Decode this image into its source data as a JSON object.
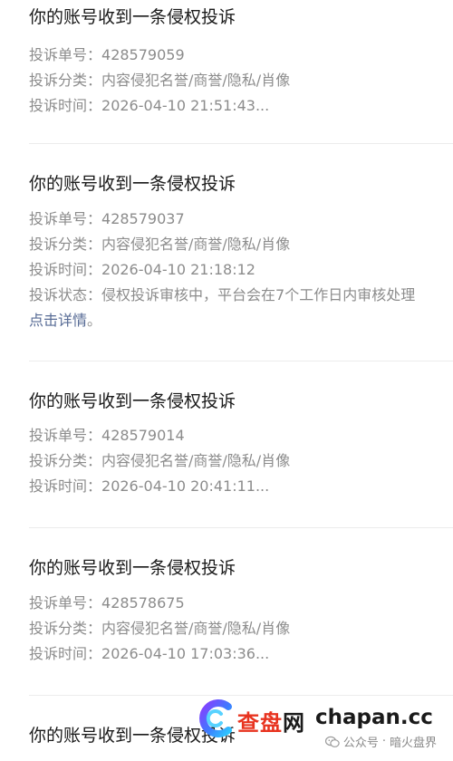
{
  "complaints": [
    {
      "title": "你的账号收到一条侵权投诉",
      "number_label": "投诉单号：",
      "number": "428579059",
      "category_label": "投诉分类：",
      "category": "内容侵犯名誉/商誉/隐私/肖像",
      "time_label": "投诉时间：",
      "time": "2026-04-10 21:51:43..."
    },
    {
      "title": "你的账号收到一条侵权投诉",
      "number_label": "投诉单号：",
      "number": "428579037",
      "category_label": "投诉分类：",
      "category": "内容侵犯名誉/商誉/隐私/肖像",
      "time_label": "投诉时间：",
      "time": "2026-04-10 21:18:12",
      "status_label": "投诉状态：",
      "status": "侵权投诉审核中，平台会在7个工作日内审核处理",
      "detail_link": "点击详情",
      "detail_suffix": "。"
    },
    {
      "title": "你的账号收到一条侵权投诉",
      "number_label": "投诉单号：",
      "number": "428579014",
      "category_label": "投诉分类：",
      "category": "内容侵犯名誉/商誉/隐私/肖像",
      "time_label": "投诉时间：",
      "time": "2026-04-10 20:41:11..."
    },
    {
      "title": "你的账号收到一条侵权投诉",
      "number_label": "投诉单号：",
      "number": "428578675",
      "category_label": "投诉分类：",
      "category": "内容侵犯名誉/商誉/隐私/肖像",
      "time_label": "投诉时间：",
      "time": "2026-04-10 17:03:36..."
    },
    {
      "title": "你的账号收到一条侵权投诉"
    }
  ],
  "watermark": {
    "brand_cn": "查盘",
    "brand_cn_suffix": "网",
    "domain": "chapan.cc",
    "account_prefix": "公众号",
    "account_separator": "·",
    "account_name": "暗火盘界",
    "logo_icon": "chapan-logo-icon",
    "wechat_icon": "wechat-official-account-icon"
  },
  "colors": {
    "title": "#1a1a1a",
    "meta_text": "#8c8c8c",
    "link": "#576b95",
    "divider": "#ececec",
    "brand_red": "#e8331f"
  }
}
